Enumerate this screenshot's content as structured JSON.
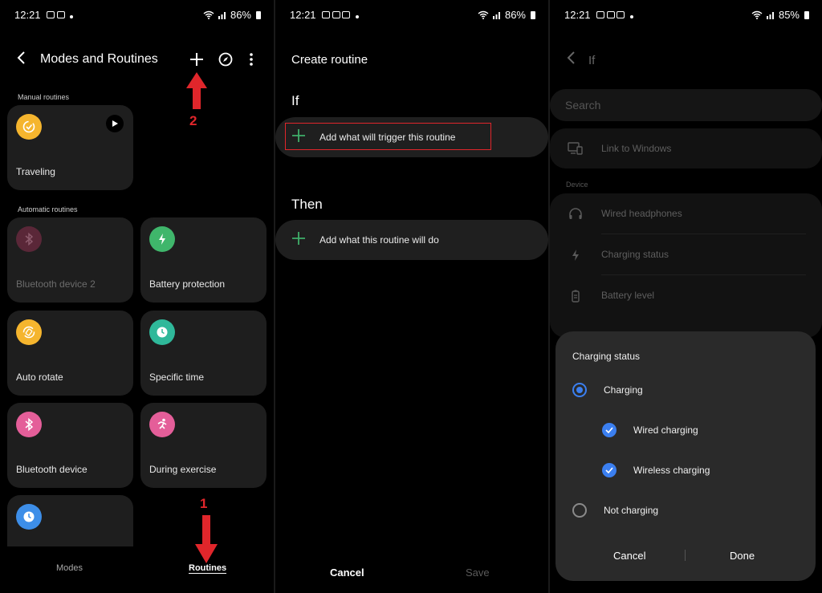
{
  "status_bars": [
    {
      "time": "12:21",
      "battery": "86%"
    },
    {
      "time": "12:21",
      "battery": "86%"
    },
    {
      "time": "12:21",
      "battery": "85%"
    }
  ],
  "panel1": {
    "title": "Modes and Routines",
    "manual_label": "Manual routines",
    "automatic_label": "Automatic routines",
    "manual_routines": [
      {
        "label": "Traveling",
        "color": "#f5b52e",
        "icon": "check-circle-icon"
      }
    ],
    "automatic_routines": [
      {
        "label": "Bluetooth device 2",
        "color": "#6b2d42",
        "icon": "bluetooth-icon",
        "disabled": true
      },
      {
        "label": "Battery protection",
        "color": "#3fb66b",
        "icon": "battery-bolt-icon"
      },
      {
        "label": "Auto rotate",
        "color": "#f5b52e",
        "icon": "rotate-icon"
      },
      {
        "label": "Specific time",
        "color": "#2fb89a",
        "icon": "clock-icon"
      },
      {
        "label": "Bluetooth device",
        "color": "#e45e99",
        "icon": "bluetooth-icon"
      },
      {
        "label": "During exercise",
        "color": "#e45e99",
        "icon": "running-icon"
      },
      {
        "label": "",
        "color": "#3d8ee8",
        "icon": "clock-icon"
      }
    ],
    "nav": {
      "modes": "Modes",
      "routines": "Routines"
    },
    "annotations": {
      "arrow_1": "1",
      "arrow_2": "2"
    }
  },
  "panel2": {
    "title": "Create routine",
    "if_label": "If",
    "then_label": "Then",
    "if_action": "Add what will trigger this routine",
    "then_action": "Add what this routine will do",
    "cancel": "Cancel",
    "save": "Save"
  },
  "panel3": {
    "header": "If",
    "search_placeholder": "Search",
    "link_to_windows": "Link to Windows",
    "device_label": "Device",
    "device_items": [
      "Wired headphones",
      "Charging status",
      "Battery level"
    ],
    "dialog": {
      "title": "Charging status",
      "options": [
        {
          "label": "Charging",
          "type": "radio",
          "selected": true
        },
        {
          "label": "Wired charging",
          "type": "check",
          "selected": true
        },
        {
          "label": "Wireless charging",
          "type": "check",
          "selected": true
        },
        {
          "label": "Not charging",
          "type": "radio",
          "selected": false
        }
      ],
      "cancel": "Cancel",
      "done": "Done"
    }
  },
  "colors": {
    "accent_blue": "#3b7ff0",
    "accent_green": "#3fae6a",
    "annotation_red": "#e0262b"
  }
}
